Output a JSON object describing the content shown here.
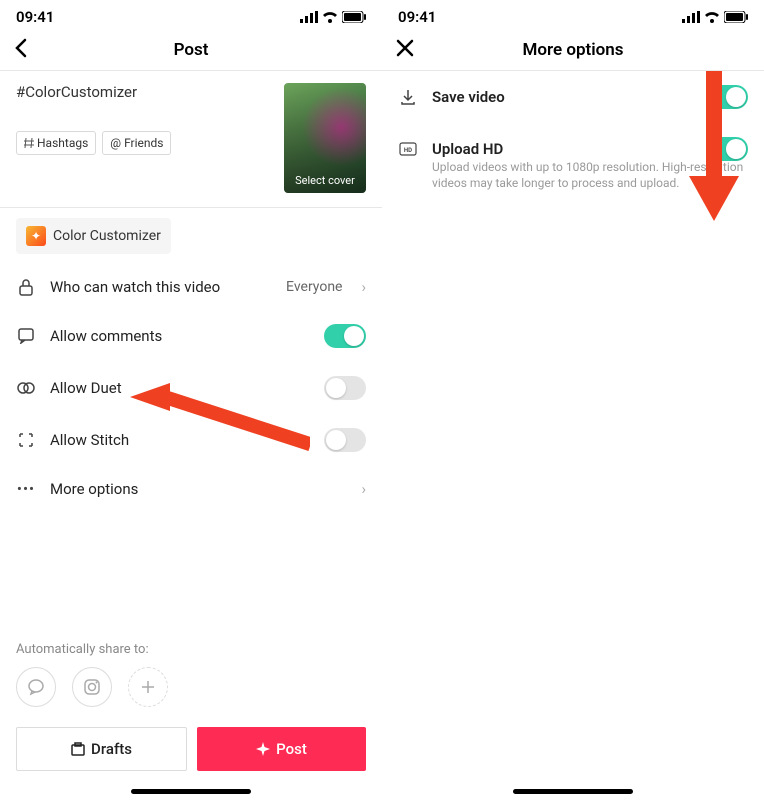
{
  "status": {
    "time": "09:41"
  },
  "left": {
    "title": "Post",
    "caption": "#ColorCustomizer",
    "chip_hashtags": "Hashtags",
    "chip_friends": "Friends",
    "cover_label": "Select cover",
    "effect_name": "Color Customizer",
    "rows": {
      "privacy": {
        "label": "Who can watch this video",
        "value": "Everyone"
      },
      "comments": {
        "label": "Allow comments"
      },
      "duet": {
        "label": "Allow Duet"
      },
      "stitch": {
        "label": "Allow Stitch"
      },
      "more": {
        "label": "More options"
      }
    },
    "share_label": "Automatically share to:",
    "drafts": "Drafts",
    "post": "Post"
  },
  "right": {
    "title": "More options",
    "save": {
      "label": "Save video"
    },
    "hd": {
      "label": "Upload HD",
      "sub": "Upload videos with up to 1080p resolution. High-resolution videos may take longer to process and upload."
    }
  }
}
